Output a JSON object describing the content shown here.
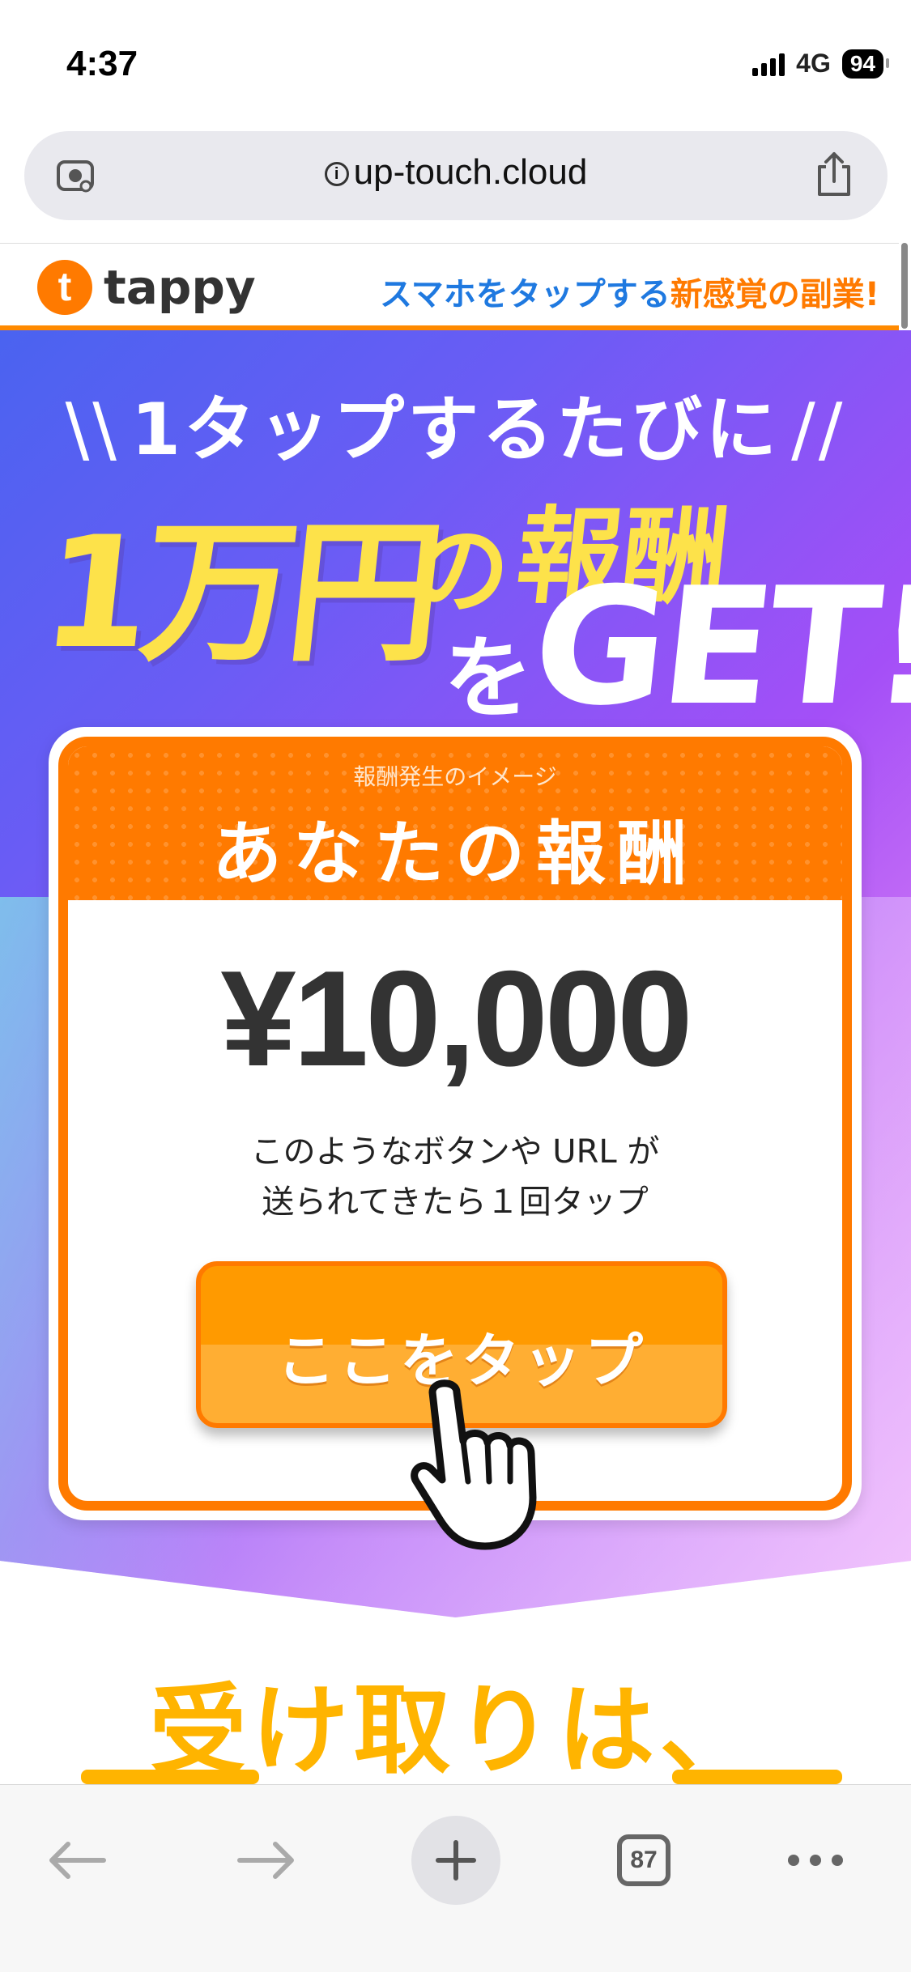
{
  "status_bar": {
    "time": "4:37",
    "network": "4G",
    "battery": "94"
  },
  "browser": {
    "url": "up-touch.cloud",
    "tab_count": "87"
  },
  "site": {
    "logo_text": "tappy",
    "tagline_part1": "スマホをタップする",
    "tagline_part2": "新感覚の副業!"
  },
  "hero": {
    "line1": "1タップするたびに",
    "big_amount": "1万円",
    "no": "の",
    "hoshu": "報酬",
    "wo": "を",
    "get": "GET!?"
  },
  "card": {
    "subtitle": "報酬発生のイメージ",
    "title": "あなたの報酬",
    "amount": "¥10,000",
    "desc_line1": "このようなボタンや URL が",
    "desc_line2": "送られてきたら１回タップ",
    "button_label": "ここをタップ"
  },
  "lower": {
    "heading": "受け取りは、"
  },
  "colors": {
    "accent_orange": "#ff7a00",
    "hero_yellow": "#fde24a",
    "tag_blue": "#1f79e0"
  }
}
